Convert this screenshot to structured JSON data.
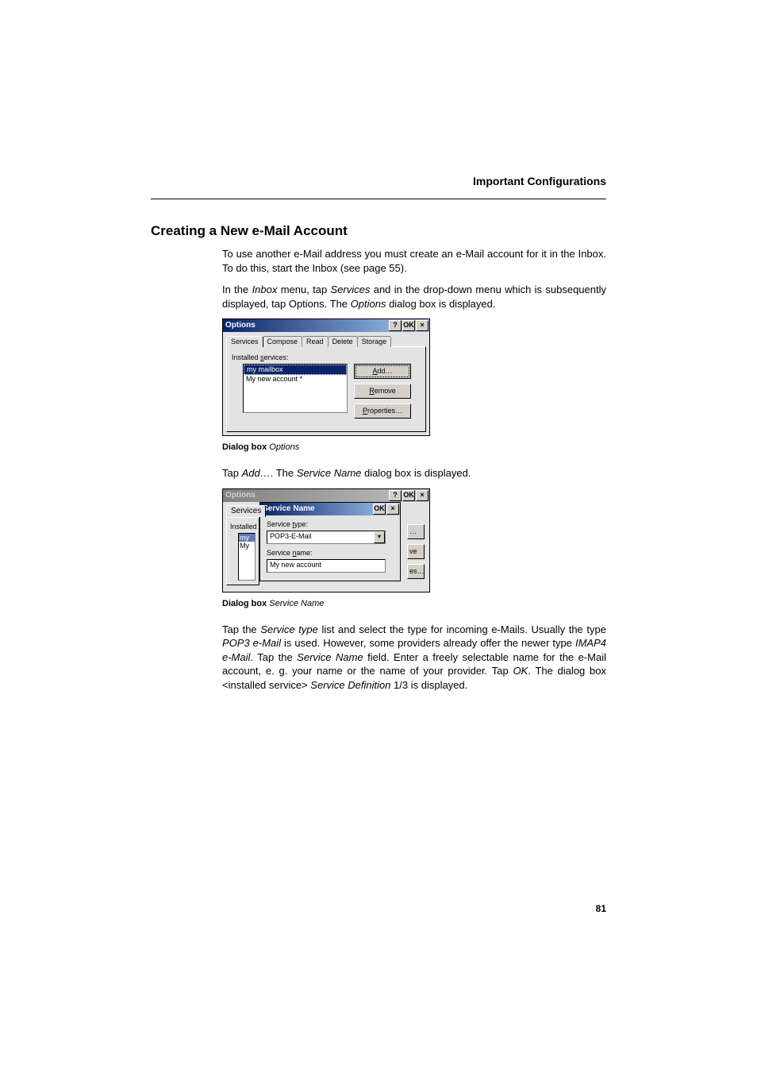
{
  "header": {
    "title": "Important Configurations"
  },
  "section_heading": "Creating a New e-Mail Account",
  "para1": {
    "t1": "To use another e-Mail address you must create an e-Mail account for it in the Inbox. To do this, start the Inbox (see page 55)."
  },
  "para2": {
    "t1": "In the ",
    "i1": "Inbox",
    "t2": " menu, tap ",
    "i2": "Services",
    "t3": " and in the drop-down menu which is subsequently displayed, tap Options. The ",
    "i3": "Options",
    "t4": " dialog box is displayed."
  },
  "options_win": {
    "title": "Options",
    "help": "?",
    "ok": "OK",
    "close": "×",
    "tabs": [
      "Services",
      "Compose",
      "Read",
      "Delete",
      "Storage"
    ],
    "list_label_pre": "Installed ",
    "list_label_key": "s",
    "list_label_post": "ervices:",
    "items": [
      "my mailbox",
      "My new account *"
    ],
    "btn_add_key": "A",
    "btn_add_rest": "dd…",
    "btn_remove_key": "R",
    "btn_remove_rest": "emove",
    "btn_props_key": "P",
    "btn_props_rest": "roperties…"
  },
  "caption1": {
    "label": "Dialog box",
    "name": "Options"
  },
  "para3": {
    "t1": "Tap ",
    "i1": "Add…",
    "t2": ". The ",
    "i2": "Service Name",
    "t3": " dialog box is displayed."
  },
  "service_win": {
    "outer_title": "Options",
    "outer_tab": "Services",
    "outer_label": "Installed",
    "outer_item1": "my",
    "outer_item2": "My",
    "inner_title": "Service Name",
    "ok": "OK",
    "close": "×",
    "help": "?",
    "type_pre": "Service ",
    "type_key": "t",
    "type_post": "ype:",
    "combo_val": "POP3-E-Mail",
    "combo_arrow": "▾",
    "name_pre": "Service ",
    "name_key": "n",
    "name_post": "ame:",
    "name_val": "My new account",
    "edge1": "…",
    "edge2": "ve",
    "edge3": "es…"
  },
  "caption2": {
    "label": "Dialog box",
    "name": "Service Name"
  },
  "para4": {
    "t1": "Tap the ",
    "i1": "Service type",
    "t2": " list and select the type for incoming e-Mails. Usually the type ",
    "i2": "POP3 e-Mail",
    "t3": " is used. However, some providers already offer the newer type ",
    "i3": "IMAP4 e-Mail",
    "t4": ". Tap the ",
    "i4": "Service Name",
    "t5": " field. Enter a freely selectable name for the e-Mail account, e. g. your name or the name of your provider. Tap ",
    "i5": "OK",
    "t6": ". The dialog box <installed service> ",
    "i6": "Service Definition",
    "t7": " 1/3 is displayed."
  },
  "page_number": "81"
}
